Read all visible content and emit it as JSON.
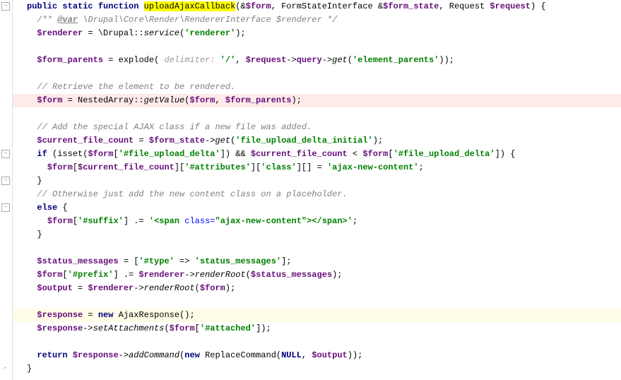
{
  "lines": {
    "l1": {
      "kw1": "public",
      "kw2": "static",
      "kw3": "function",
      "fn": "uploadAjaxCallback",
      "p1": "(&",
      "v1": "$form",
      "c1": ", ",
      "t1": "FormStateInterface ",
      "amp": "&",
      "v2": "$form_state",
      "c2": ", ",
      "t2": "Request ",
      "v3": "$request",
      "p2": ") {"
    },
    "l2": {
      "c1": "/** ",
      "tag": "@var",
      "c2": " \\Drupal\\Core\\Render\\RendererInterface $renderer */"
    },
    "l3": {
      "v1": "$renderer",
      "eq": " = \\Drupal::",
      "m": "service",
      "p1": "(",
      "s1": "'renderer'",
      "p2": ");"
    },
    "l5": {
      "v1": "$form_parents",
      "eq": " = ",
      "fn": "explode",
      "p1": "( ",
      "hint": "delimiter: ",
      "s1": "'/'",
      "c1": ", ",
      "v2": "$request",
      "arr": "->",
      "prop": "query",
      "arr2": "->",
      "m": "get",
      "p2": "(",
      "s2": "'element_parents'",
      "p3": "));"
    },
    "l7": {
      "c": "// Retrieve the element to be rendered."
    },
    "l8": {
      "v1": "$form",
      "eq": " = NestedArray::",
      "m": "getValue",
      "p1": "(",
      "v2": "$form",
      "c1": ", ",
      "v3": "$form_parents",
      "p2": ");"
    },
    "l10": {
      "c": "// Add the special AJAX class if a new file was added."
    },
    "l11": {
      "v1": "$current_file_count",
      "eq": " = ",
      "v2": "$form_state",
      "arr": "->",
      "m": "get",
      "p1": "(",
      "s1": "'file_upload_delta_initial'",
      "p2": ");"
    },
    "l12": {
      "kw": "if",
      "p1": " (",
      "fn": "isset",
      "p2": "(",
      "v1": "$form",
      "b1": "[",
      "s1": "'#file_upload_delta'",
      "b2": "]) && ",
      "v2": "$current_file_count",
      "lt": " < ",
      "v3": "$form",
      "b3": "[",
      "s2": "'#file_upload_delta'",
      "b4": "]) {"
    },
    "l13": {
      "v1": "$form",
      "b1": "[",
      "v2": "$current_file_count",
      "b2": "][",
      "s1": "'#attributes'",
      "b3": "][",
      "s2": "'class'",
      "b4": "][] = ",
      "s3": "'ajax-new-content'",
      "semi": ";"
    },
    "l14": {
      "b": "}"
    },
    "l15": {
      "c": "// Otherwise just add the new content class on a placeholder."
    },
    "l16": {
      "kw": "else",
      "b": " {"
    },
    "l17": {
      "v1": "$form",
      "b1": "[",
      "s1": "'#suffix'",
      "b2": "] .= ",
      "q1": "'",
      "t1": "<",
      "tag1": "span ",
      "attr": "class=",
      "val": "\"ajax-new-content\"",
      "t2": "></",
      "tag2": "span",
      "t3": ">",
      "q2": "'",
      "semi": ";"
    },
    "l18": {
      "b": "}"
    },
    "l20": {
      "v1": "$status_messages",
      "eq": " = [",
      "s1": "'#type'",
      "arr": " => ",
      "s2": "'status_messages'",
      "b": "];"
    },
    "l21": {
      "v1": "$form",
      "b1": "[",
      "s1": "'#prefix'",
      "b2": "] .= ",
      "v2": "$renderer",
      "arr": "->",
      "m": "renderRoot",
      "p1": "(",
      "v3": "$status_messages",
      "p2": ");"
    },
    "l22": {
      "v1": "$output",
      "eq": " = ",
      "v2": "$renderer",
      "arr": "->",
      "m": "renderRoot",
      "p1": "(",
      "v3": "$form",
      "p2": ");"
    },
    "l24": {
      "v1": "$response",
      "eq": " = ",
      "kw": "new",
      "sp": " ",
      "cls": "AjaxResponse",
      "p": "();"
    },
    "l25": {
      "v1": "$response",
      "arr": "->",
      "m": "setAttachments",
      "p1": "(",
      "v2": "$form",
      "b1": "[",
      "s1": "'#attached'",
      "b2": "]);"
    },
    "l27": {
      "kw": "return",
      "sp": " ",
      "v1": "$response",
      "arr": "->",
      "m": "addCommand",
      "p1": "(",
      "kw2": "new",
      "sp2": " ",
      "cls": "ReplaceCommand",
      "p2": "(",
      "null": "NULL",
      "c1": ", ",
      "v2": "$output",
      "p3": "));"
    },
    "l28": {
      "b": "}"
    }
  }
}
